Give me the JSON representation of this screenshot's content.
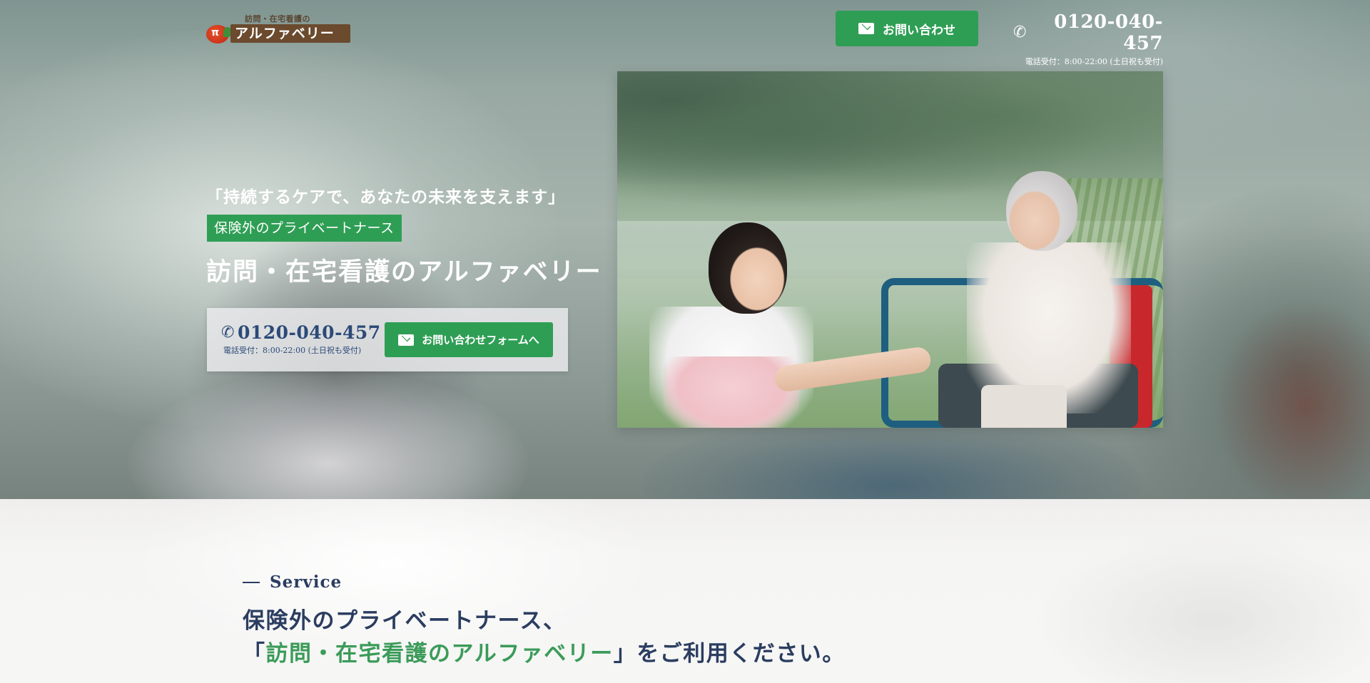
{
  "header": {
    "logo_subtitle": "訪問・在宅看護の",
    "logo_name": "アルファベリー",
    "logo_mark": "π",
    "contact_button_label": "お問い合わせ",
    "phone_number": "0120-040-457",
    "phone_hours": "電話受付：8:00-22:00 (土日祝も受付)"
  },
  "hero": {
    "tagline": "「持続するケアで、あなたの未来を支えます」",
    "badge": "保険外のプライベートナース",
    "title": "訪問・在宅看護のアルファベリー",
    "cta_phone_number": "0120-040-457",
    "cta_phone_hours": "電話受付：8:00-22:00 (土日祝も受付)",
    "cta_form_label": "お問い合わせフォームへ"
  },
  "service": {
    "label": "Service",
    "heading_line1": "保険外のプライベートナース、",
    "heading_open": "「",
    "heading_highlight": "訪問・在宅看護のアルファベリー",
    "heading_close": "」をご利用ください。"
  },
  "colors": {
    "brand_green": "#2f9e55",
    "navy": "#2b3d60",
    "logo_brown": "#6b4a2e"
  },
  "icons": {
    "mail": "mail-icon",
    "phone": "phone-icon"
  }
}
